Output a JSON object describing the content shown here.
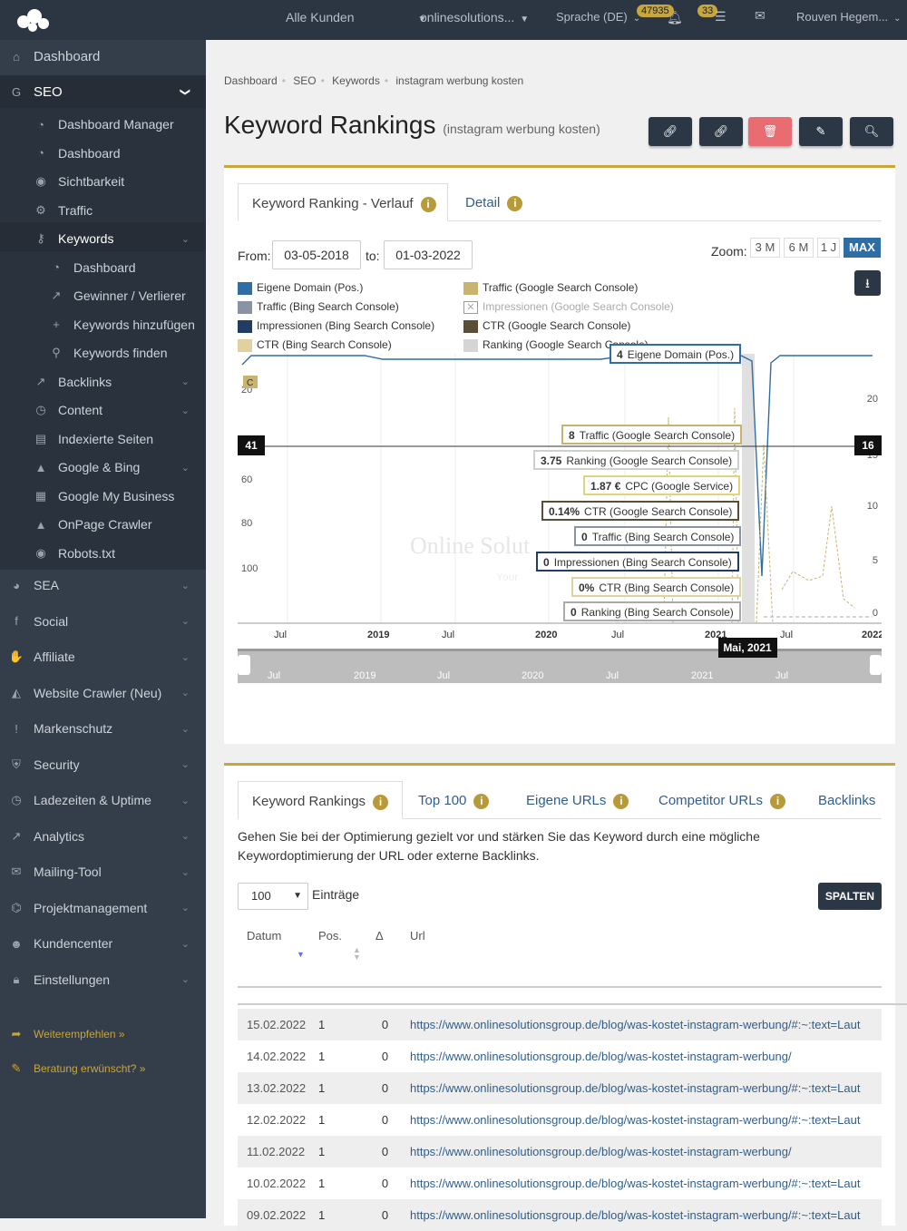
{
  "topbar": {
    "clients": "Alle Kunden",
    "project": "onlinesolutions...",
    "language": "Sprache (DE)",
    "notif_count": "47935",
    "messages_count": "33",
    "user": "Rouven Hegem..."
  },
  "sidebar": {
    "top": [
      {
        "label": "Dashboard",
        "icon": "home-icon"
      },
      {
        "label": "SEO",
        "icon": "google-icon"
      }
    ],
    "seo": [
      {
        "label": "Dashboard Manager",
        "icon": "dashboard-icon"
      },
      {
        "label": "Dashboard",
        "icon": "dashboard-icon"
      },
      {
        "label": "Sichtbarkeit",
        "icon": "eye-icon"
      },
      {
        "label": "Traffic",
        "icon": "cogs-icon"
      },
      {
        "label": "Keywords",
        "icon": "key-icon"
      }
    ],
    "kw": [
      {
        "label": "Dashboard",
        "icon": "dashboard-icon"
      },
      {
        "label": "Gewinner / Verlierer",
        "icon": "external-icon"
      },
      {
        "label": "Keywords hinzufügen",
        "icon": "plus-icon"
      },
      {
        "label": "Keywords finden",
        "icon": "search-icon"
      }
    ],
    "seo2": [
      {
        "label": "Backlinks",
        "icon": "external-icon"
      },
      {
        "label": "Content",
        "icon": "clock-icon"
      },
      {
        "label": "Indexierte Seiten",
        "icon": "file-icon"
      },
      {
        "label": "Google & Bing",
        "icon": "chart-icon"
      },
      {
        "label": "Google My Business",
        "icon": "building-icon"
      },
      {
        "label": "OnPage Crawler",
        "icon": "chart-icon"
      },
      {
        "label": "Robots.txt",
        "icon": "eye-icon"
      }
    ],
    "main": [
      {
        "label": "SEA",
        "icon": "pie-icon"
      },
      {
        "label": "Social",
        "icon": "facebook-icon"
      },
      {
        "label": "Affiliate",
        "icon": "handshake-icon"
      },
      {
        "label": "Website Crawler (Neu)",
        "icon": "area-chart-icon"
      },
      {
        "label": "Markenschutz",
        "icon": "exclamation-icon"
      },
      {
        "label": "Security",
        "icon": "shield-icon"
      },
      {
        "label": "Ladezeiten & Uptime",
        "icon": "clock-icon"
      },
      {
        "label": "Analytics",
        "icon": "line-chart-icon"
      },
      {
        "label": "Mailing-Tool",
        "icon": "envelope-icon"
      },
      {
        "label": "Projektmanagement",
        "icon": "sitemap-icon"
      },
      {
        "label": "Kundencenter",
        "icon": "users-icon"
      },
      {
        "label": "Einstellungen",
        "icon": "lock-icon"
      }
    ],
    "footer": [
      {
        "label": "Weiterempfehlen »",
        "icon": "share-icon"
      },
      {
        "label": "Beratung erwünscht? »",
        "icon": "comments-icon"
      }
    ]
  },
  "breadcrumb": [
    "Dashboard",
    "SEO",
    "Keywords",
    "instagram werbung kosten"
  ],
  "page": {
    "title": "Keyword Rankings",
    "subtitle": "(instagram werbung kosten)"
  },
  "chart_panel": {
    "tab1": "Keyword Ranking - Verlauf",
    "tab2": "Detail",
    "from_label": "From:",
    "from": "03-05-2018",
    "to_label": "to:",
    "to": "01-03-2022",
    "zoom_label": "Zoom:",
    "zoom": [
      "3 M",
      "6 M",
      "1 J",
      "MAX"
    ],
    "watermark": "Online Solut",
    "watermark2": "Your",
    "legend": [
      {
        "label": "Eigene Domain (Pos.)",
        "color": "#2f6ea5"
      },
      {
        "label": "Traffic (Google Search Console)",
        "color": "#c9b46f"
      },
      {
        "label": "Traffic (Bing Search Console)",
        "color": "#8a93a4"
      },
      {
        "label": "Impressionen (Google Search Console)",
        "color": "#ffffff"
      },
      {
        "label": "Impressionen (Bing Search Console)",
        "color": "#213d63"
      },
      {
        "label": "CTR (Google Search Console)",
        "color": "#5a4e37"
      },
      {
        "label": "CTR (Bing Search Console)",
        "color": "#e0d1a0"
      },
      {
        "label": "Ranking (Google Search Console)",
        "color": "#d5d5d5"
      }
    ],
    "tooltips": [
      {
        "v": "4",
        "t": "Eigene Domain (Pos.)",
        "c": "#2f6ea5"
      },
      {
        "v": "8",
        "t": "Traffic (Google Search Console)",
        "c": "#c9b46f"
      },
      {
        "v": "3.75",
        "t": "Ranking (Google Search Console)",
        "c": "#cfcfcf"
      },
      {
        "v": "1.87 €",
        "t": "CPC (Google Service)",
        "c": "#e3d47a"
      },
      {
        "v": "0.14%",
        "t": "CTR (Google Search Console)",
        "c": "#5a4e37"
      },
      {
        "v": "0",
        "t": "Traffic (Bing Search Console)",
        "c": "#8a93a4"
      },
      {
        "v": "0",
        "t": "Impressionen (Bing Search Console)",
        "c": "#213d63"
      },
      {
        "v": "0%",
        "t": "CTR (Bing Search Console)",
        "c": "#e0d1a0"
      },
      {
        "v": "0",
        "t": "Ranking (Bing Search Console)",
        "c": "#aaaaaa"
      }
    ],
    "date_tip": "Mai, 2021",
    "left_marker": "41",
    "right_marker": "16",
    "c_marker": "C"
  },
  "chart_data": {
    "type": "line",
    "title": "",
    "x_ticks": [
      "Jul",
      "2019",
      "Jul",
      "2020",
      "Jul",
      "2021",
      "Jul",
      "2022"
    ],
    "y_left": {
      "reversed": true,
      "ticks": [
        20,
        40,
        60,
        80,
        100
      ]
    },
    "y_right": {
      "ticks": [
        0,
        5,
        10,
        15,
        20
      ]
    },
    "navigator_ticks": [
      "Jul",
      "2019",
      "Jul",
      "2020",
      "Jul",
      "2021",
      "Jul"
    ],
    "series": [
      {
        "name": "Eigene Domain (Pos.)",
        "axis": "left",
        "x": [
          "2018-05",
          "2018-07",
          "2019-01",
          "2019-07",
          "2020-01",
          "2020-07",
          "2021-01",
          "2021-05",
          "2021-06",
          "2021-07",
          "2021-12",
          "2022-03"
        ],
        "y": [
          5,
          4,
          4,
          4,
          4,
          4,
          4,
          4,
          100,
          4,
          4,
          4
        ]
      }
    ],
    "series_2": {
      "name": "Traffic (Google Search Console)",
      "axis": "right",
      "x": [
        "2021-06",
        "2021-08",
        "2021-10",
        "2021-12",
        "2022-02"
      ],
      "y": [
        2,
        3,
        4,
        12,
        1
      ]
    },
    "selected_point": {
      "date": "Mai, 2021"
    }
  },
  "table_panel": {
    "tabs": [
      "Keyword Rankings",
      "Top 100",
      "Eigene URLs",
      "Competitor URLs",
      "Backlinks"
    ],
    "description": "Gehen Sie bei der Optimierung gezielt vor und stärken Sie das Keyword durch eine mögliche Keywordoptimierung der URL oder externe Backlinks.",
    "page_size": "100",
    "entries_label": "Einträge",
    "columns_button": "SPALTEN",
    "columns": [
      "Datum",
      "Pos.",
      "Δ",
      "Url"
    ],
    "rows": [
      {
        "date": "15.02.2022",
        "pos": "1",
        "delta": "0",
        "url": "https://www.onlinesolutionsgroup.de/blog/was-kostet-instagram-werbung/#:~:text=Laut"
      },
      {
        "date": "14.02.2022",
        "pos": "1",
        "delta": "0",
        "url": "https://www.onlinesolutionsgroup.de/blog/was-kostet-instagram-werbung/"
      },
      {
        "date": "13.02.2022",
        "pos": "1",
        "delta": "0",
        "url": "https://www.onlinesolutionsgroup.de/blog/was-kostet-instagram-werbung/#:~:text=Laut"
      },
      {
        "date": "12.02.2022",
        "pos": "1",
        "delta": "0",
        "url": "https://www.onlinesolutionsgroup.de/blog/was-kostet-instagram-werbung/#:~:text=Laut"
      },
      {
        "date": "11.02.2022",
        "pos": "1",
        "delta": "0",
        "url": "https://www.onlinesolutionsgroup.de/blog/was-kostet-instagram-werbung/"
      },
      {
        "date": "10.02.2022",
        "pos": "1",
        "delta": "0",
        "url": "https://www.onlinesolutionsgroup.de/blog/was-kostet-instagram-werbung/#:~:text=Laut"
      },
      {
        "date": "09.02.2022",
        "pos": "1",
        "delta": "0",
        "url": "https://www.onlinesolutionsgroup.de/blog/was-kostet-instagram-werbung/#:~:text=Laut"
      }
    ]
  }
}
